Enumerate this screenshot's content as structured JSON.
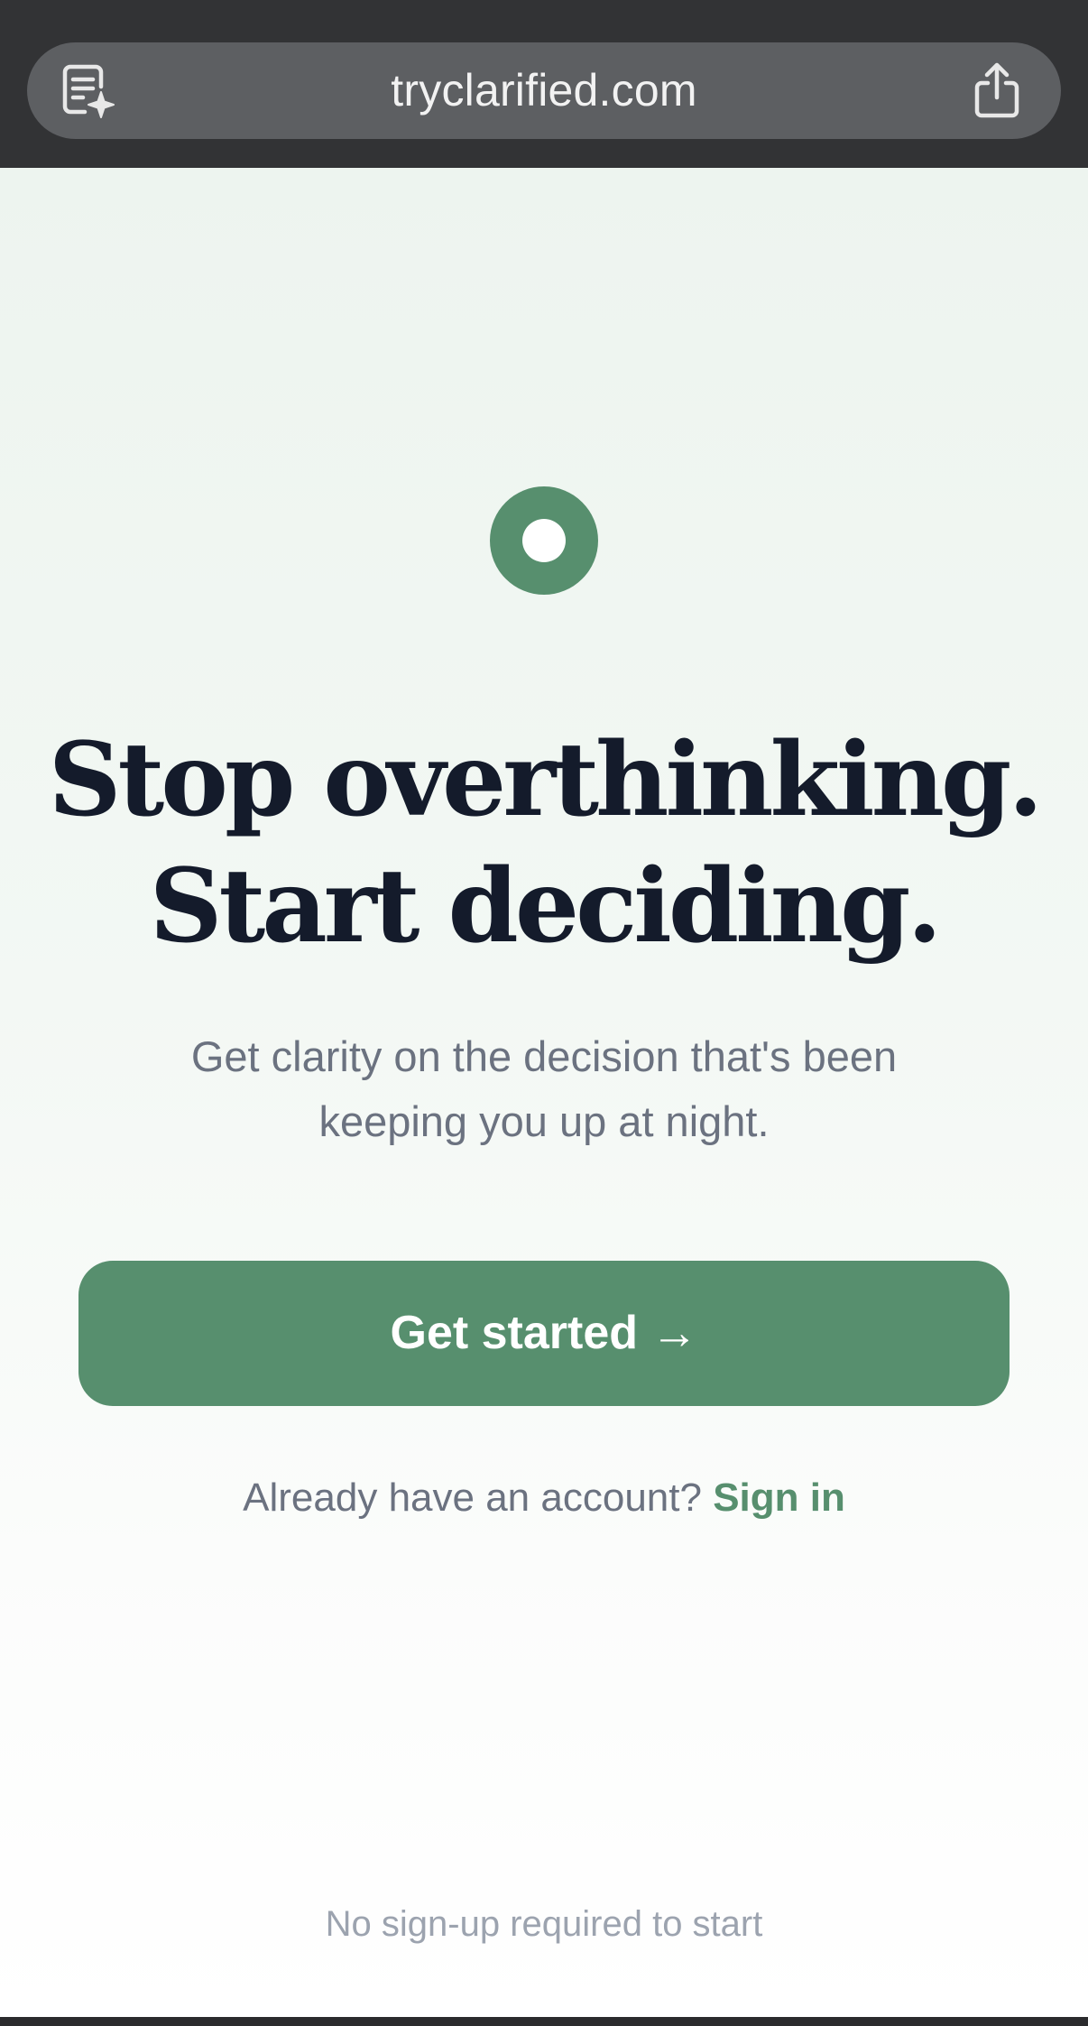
{
  "browser": {
    "url": "tryclarified.com",
    "reader_icon": "reader-sparkle-icon",
    "share_icon": "share-icon"
  },
  "hero": {
    "logo_icon": "ring-logo-icon",
    "headline_line1": "Stop overthinking.",
    "headline_line2": "Start deciding.",
    "subtext": "Get clarity on the decision that's been keeping you up at night."
  },
  "cta": {
    "label": "Get started →"
  },
  "signin": {
    "prompt": "Already have an account?",
    "link_label": "Sign in"
  },
  "footer": {
    "note": "No sign-up required to start"
  },
  "colors": {
    "accent": "#578f6e",
    "heading": "#141b2b",
    "body_text": "#6b7280",
    "muted_text": "#9ca3af",
    "browser_chrome": "#323335"
  }
}
